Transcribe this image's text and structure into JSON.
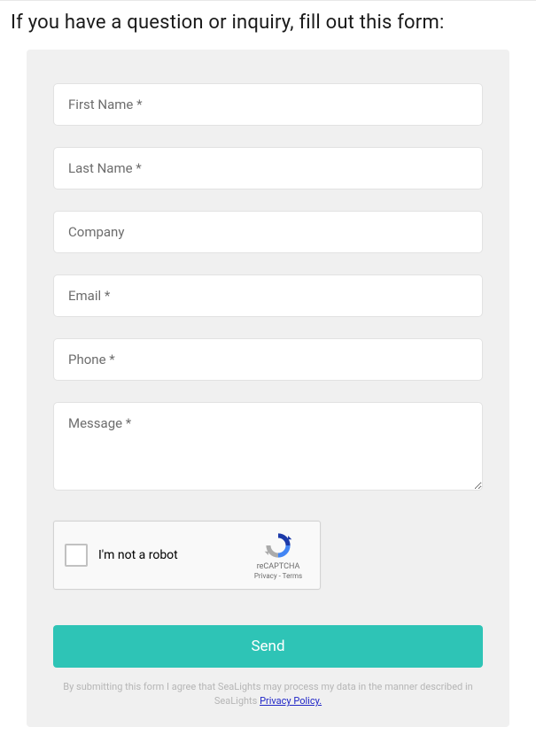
{
  "heading": "If you have a question or inquiry, fill out this form:",
  "fields": {
    "first_name": {
      "placeholder": "First Name *"
    },
    "last_name": {
      "placeholder": "Last Name *"
    },
    "company": {
      "placeholder": "Company"
    },
    "email": {
      "placeholder": "Email *"
    },
    "phone": {
      "placeholder": "Phone *"
    },
    "message": {
      "placeholder": "Message *"
    }
  },
  "recaptcha": {
    "label": "I'm not a robot",
    "brand": "reCAPTCHA",
    "links": "Privacy - Terms"
  },
  "submit_label": "Send",
  "disclaimer": {
    "prefix": "By submitting this form I agree that SeaLights may process my data in the manner described in SeaLights ",
    "link_text": "Privacy Policy."
  }
}
